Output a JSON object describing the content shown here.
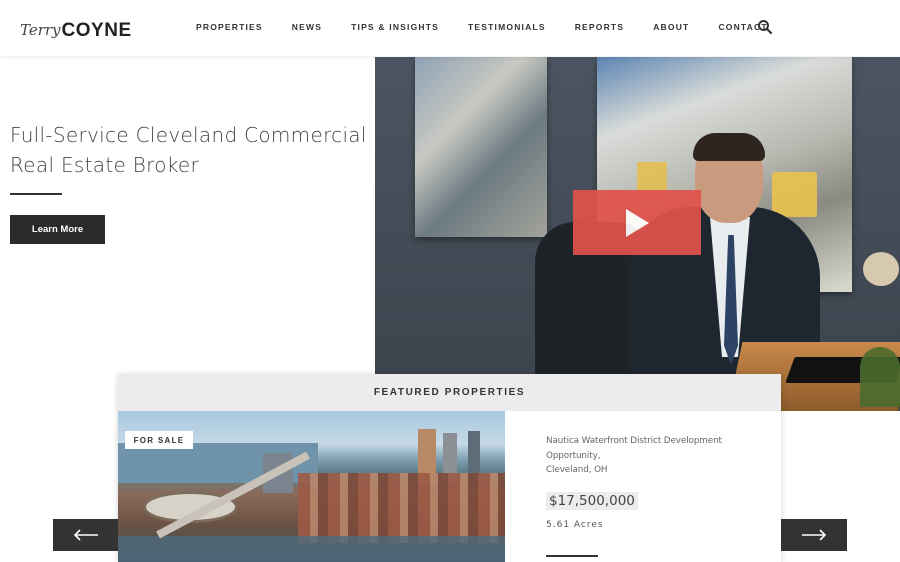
{
  "header": {
    "logo_script": "Terry",
    "logo_name": "COYNE",
    "nav": [
      "PROPERTIES",
      "NEWS",
      "TIPS & INSIGHTS",
      "TESTIMONIALS",
      "REPORTS",
      "ABOUT",
      "CONTACT"
    ],
    "search_icon": "search-icon"
  },
  "hero": {
    "title_line1": "Full-Service Cleveland Commercial",
    "title_line2": "Real Estate Broker",
    "button_label": "Learn More",
    "play_icon": "play-icon"
  },
  "featured": {
    "title": "FEATURED PROPERTIES",
    "badge": "FOR SALE",
    "property_name": "Nautica Waterfront District Development Opportunity,",
    "property_location": "Cleveland, OH",
    "price": "$17,500,000",
    "acres": "5.61 Acres"
  },
  "carousel": {
    "prev_icon": "arrow-left-icon",
    "next_icon": "arrow-right-icon"
  },
  "colors": {
    "accent": "#e0524b",
    "dark": "#2b2b2b"
  }
}
